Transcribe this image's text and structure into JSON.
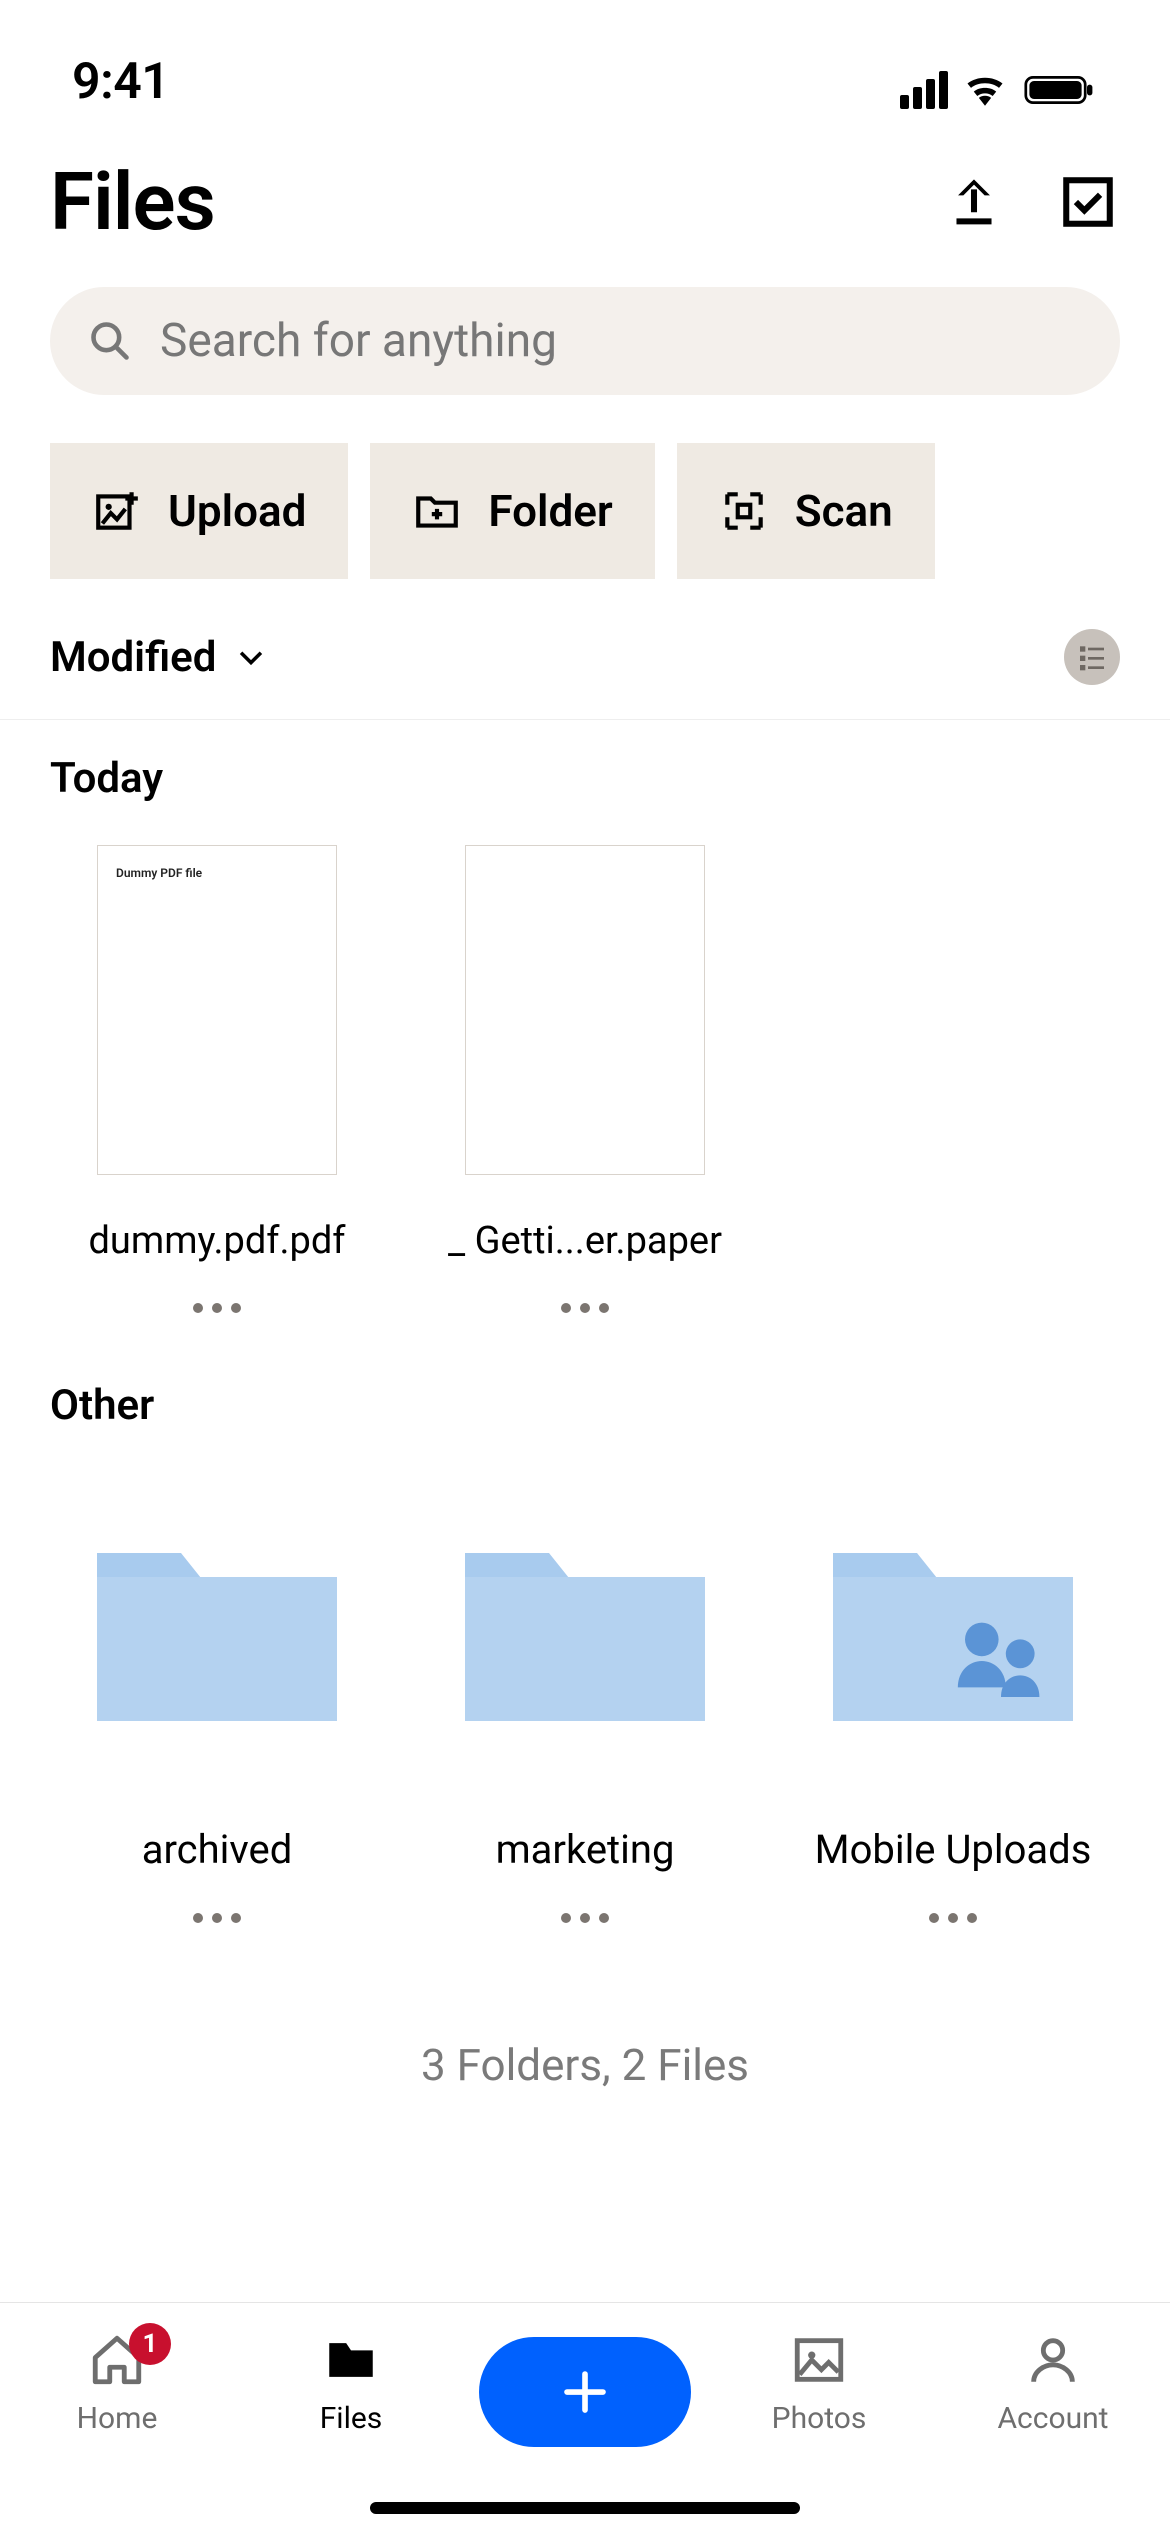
{
  "status": {
    "time": "9:41"
  },
  "page": {
    "title": "Files"
  },
  "search": {
    "placeholder": "Search for anything"
  },
  "actions": {
    "upload": "Upload",
    "folder": "Folder",
    "scan": "Scan"
  },
  "sort": {
    "label": "Modified"
  },
  "sections": {
    "today": {
      "heading": "Today",
      "files": [
        {
          "name": "dummy.pdf.pdf"
        },
        {
          "name": "_ Getti...er.paper"
        }
      ]
    },
    "other": {
      "heading": "Other",
      "folders": [
        {
          "name": "archived",
          "shared": false
        },
        {
          "name": "marketing",
          "shared": false
        },
        {
          "name": "Mobile Uploads",
          "shared": true
        }
      ]
    }
  },
  "summary": "3 Folders, 2 Files",
  "tabs": {
    "home": {
      "label": "Home",
      "badge": "1"
    },
    "files": {
      "label": "Files"
    },
    "photos": {
      "label": "Photos"
    },
    "account": {
      "label": "Account"
    }
  }
}
